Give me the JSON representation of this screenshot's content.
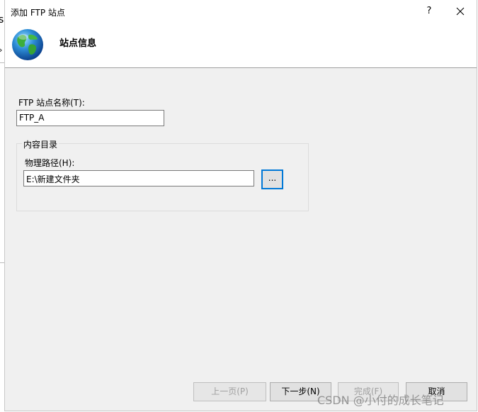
{
  "window": {
    "title": "添加 FTP 站点",
    "help_label": "?"
  },
  "header": {
    "title": "站点信息"
  },
  "form": {
    "ftp_name_label": "FTP 站点名称(T):",
    "ftp_name_value": "FTP_A",
    "content_group_label": "内容目录",
    "path_label": "物理路径(H):",
    "path_value": "E:\\新建文件夹",
    "browse_label": "..."
  },
  "buttons": {
    "prev_label": "上一页(P)",
    "next_label": "下一步(N)",
    "finish_label": "完成(F)",
    "cancel_label": "取消"
  },
  "left_edge": {
    "glyph1": "s",
    "glyph2": "›"
  },
  "watermark": "CSDN @小付的成长笔记",
  "colors": {
    "dialog_bg": "#f0f0f0",
    "focus_border": "#0078d7",
    "button_bg": "#e1e1e1"
  }
}
